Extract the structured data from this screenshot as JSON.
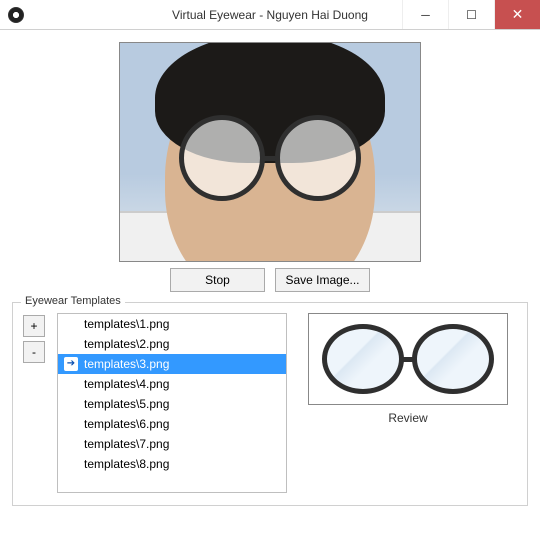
{
  "window": {
    "title": "Virtual Eyewear - Nguyen Hai Duong"
  },
  "buttons": {
    "stop": "Stop",
    "save_image": "Save Image...",
    "add": "+",
    "remove": "-"
  },
  "group": {
    "legend": "Eyewear Templates",
    "review_label": "Review"
  },
  "templates": {
    "items": [
      "templates\\1.png",
      "templates\\2.png",
      "templates\\3.png",
      "templates\\4.png",
      "templates\\5.png",
      "templates\\6.png",
      "templates\\7.png",
      "templates\\8.png"
    ],
    "selected_index": 2
  }
}
